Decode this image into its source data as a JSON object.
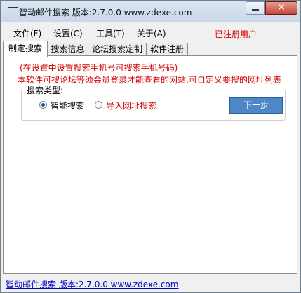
{
  "window": {
    "title": "智动邮件搜索 版本:2.7.0.0 www.zdexe.com"
  },
  "menu": {
    "items": [
      "文件(F)",
      "设置(C)",
      "工具(T)",
      "关于(A)"
    ],
    "registered": "已注册用户"
  },
  "tabs": [
    "制定搜索",
    "搜索信息",
    "论坛搜索定制",
    "软件注册"
  ],
  "panel": {
    "hint": "(在设置中设置搜索手机号可搜索手机号码)",
    "description": "本软件可搜论坛等须会员登录才能查看的网站,可自定义要搜的网址列表",
    "group_label": "搜索类型:",
    "options": [
      "智能搜索",
      "导入网址搜索"
    ],
    "selected_option": "智能搜索",
    "next_button": "下一步"
  },
  "status": {
    "link": "智动邮件搜索 版本:2.7.0.0 www.zdexe.com"
  },
  "colors": {
    "accent_red": "#d40000",
    "button_blue": "#4e87c6",
    "link_blue": "#0000d0"
  }
}
